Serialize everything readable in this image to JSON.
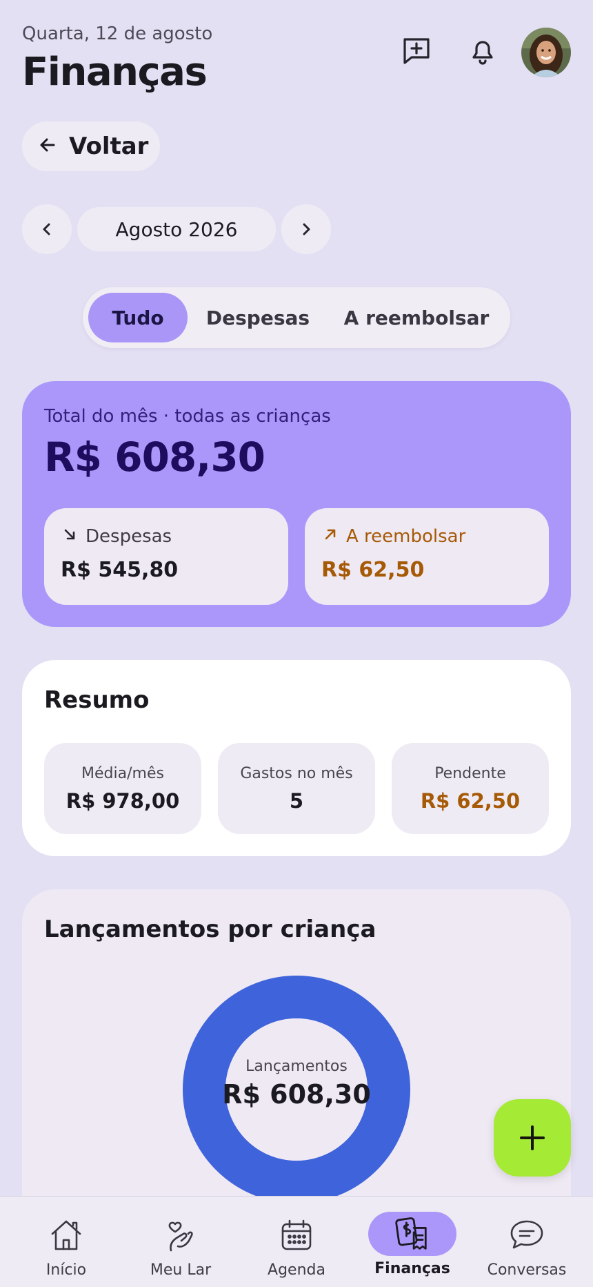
{
  "header": {
    "date": "Quarta, 12 de agosto",
    "title": "Finanças",
    "icons": [
      "chat-add-icon",
      "bell-icon",
      "avatar"
    ]
  },
  "back": {
    "label": "Voltar"
  },
  "month_nav": {
    "label": "Agosto 2026"
  },
  "filters": {
    "tabs": [
      "Tudo",
      "Despesas",
      "A reembolsar"
    ],
    "selected": "Tudo"
  },
  "total_card": {
    "label": "Total do mês · todas as crianças",
    "value": "R$ 608,30",
    "expenses": {
      "label": "Despesas",
      "value": "R$ 545,80"
    },
    "reimburse": {
      "label": "A reembolsar",
      "value": "R$ 62,50"
    }
  },
  "summary": {
    "title": "Resumo",
    "stats": [
      {
        "label": "Média/mês",
        "value": "R$ 978,00"
      },
      {
        "label": "Gastos no mês",
        "value": "5"
      },
      {
        "label": "Pendente",
        "value": "R$ 62,50"
      }
    ]
  },
  "entries_by_child": {
    "title": "Lançamentos por criança",
    "center_label": "Lançamentos",
    "center_value": "R$ 608,30"
  },
  "bottom_nav": {
    "items": [
      "Início",
      "Meu Lar",
      "Agenda",
      "Finanças",
      "Conversas"
    ],
    "active": "Finanças"
  },
  "colors": {
    "background": "#e4e0f3",
    "accent": "#ab97fa",
    "reimburse": "#a65a06",
    "donut": "#3f63da",
    "fab": "#a5ea35"
  }
}
